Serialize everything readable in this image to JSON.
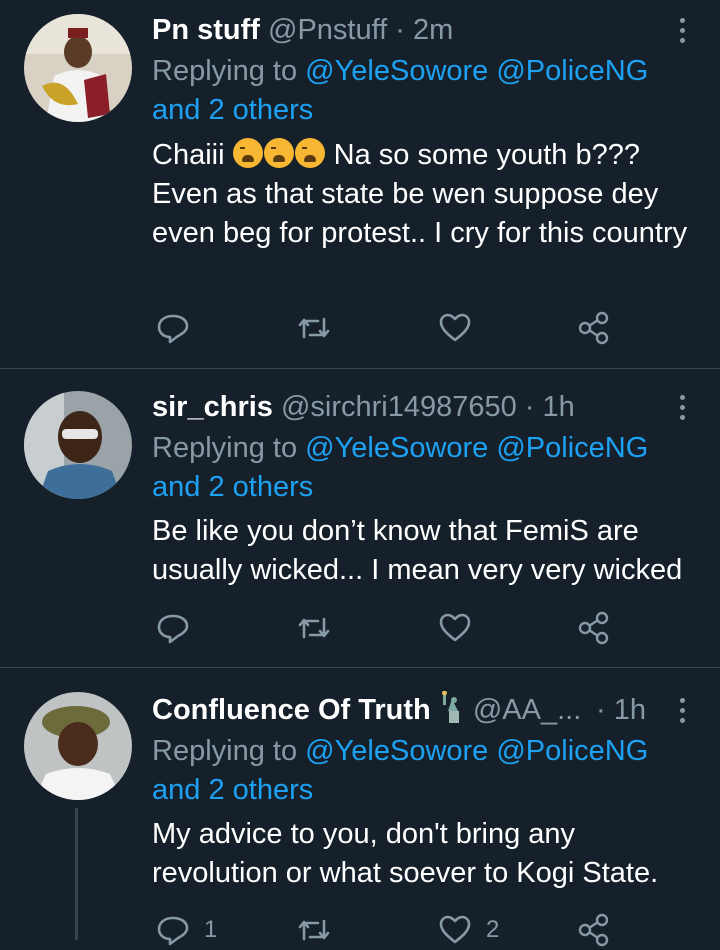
{
  "tweets": [
    {
      "name": "Pn stuff",
      "handle": "@Pnstuff",
      "time": "· 2m",
      "replying_prefix": "Replying to",
      "mentions": "@YeleSowore @PoliceNG",
      "others": "and 2 others",
      "text_line1_a": "Chaiii",
      "text_line1_b": "Na so some youth b???",
      "text_rest": "Even as that state be wen suppose dey even beg for protest.. I cry for this country",
      "reply_count": "",
      "like_count": ""
    },
    {
      "name": "sir_chris",
      "handle": "@sirchri14987650",
      "time": "· 1h",
      "replying_prefix": "Replying to",
      "mentions": "@YeleSowore @PoliceNG",
      "others": "and 2 others",
      "text": "Be like you don’t know that FemiS are usually wicked... I mean very very wicked",
      "reply_count": "",
      "like_count": ""
    },
    {
      "name": "Confluence Of Truth",
      "handle": "@AA_...",
      "time": "· 1h",
      "replying_prefix": "Replying to",
      "mentions": "@YeleSowore @PoliceNG",
      "others": "and 2 others",
      "text": "My advice to you, don't bring any revolution or what soever to Kogi State.",
      "reply_count": "1",
      "like_count": "2"
    }
  ],
  "colors": {
    "background": "#15202b",
    "muted": "#8899a6",
    "link": "#1da1f2",
    "divider": "#38444d"
  },
  "icons": [
    "reply-icon",
    "retweet-icon",
    "like-icon",
    "share-icon",
    "more-icon",
    "crying-emoji-icon",
    "statue-of-liberty-icon"
  ]
}
